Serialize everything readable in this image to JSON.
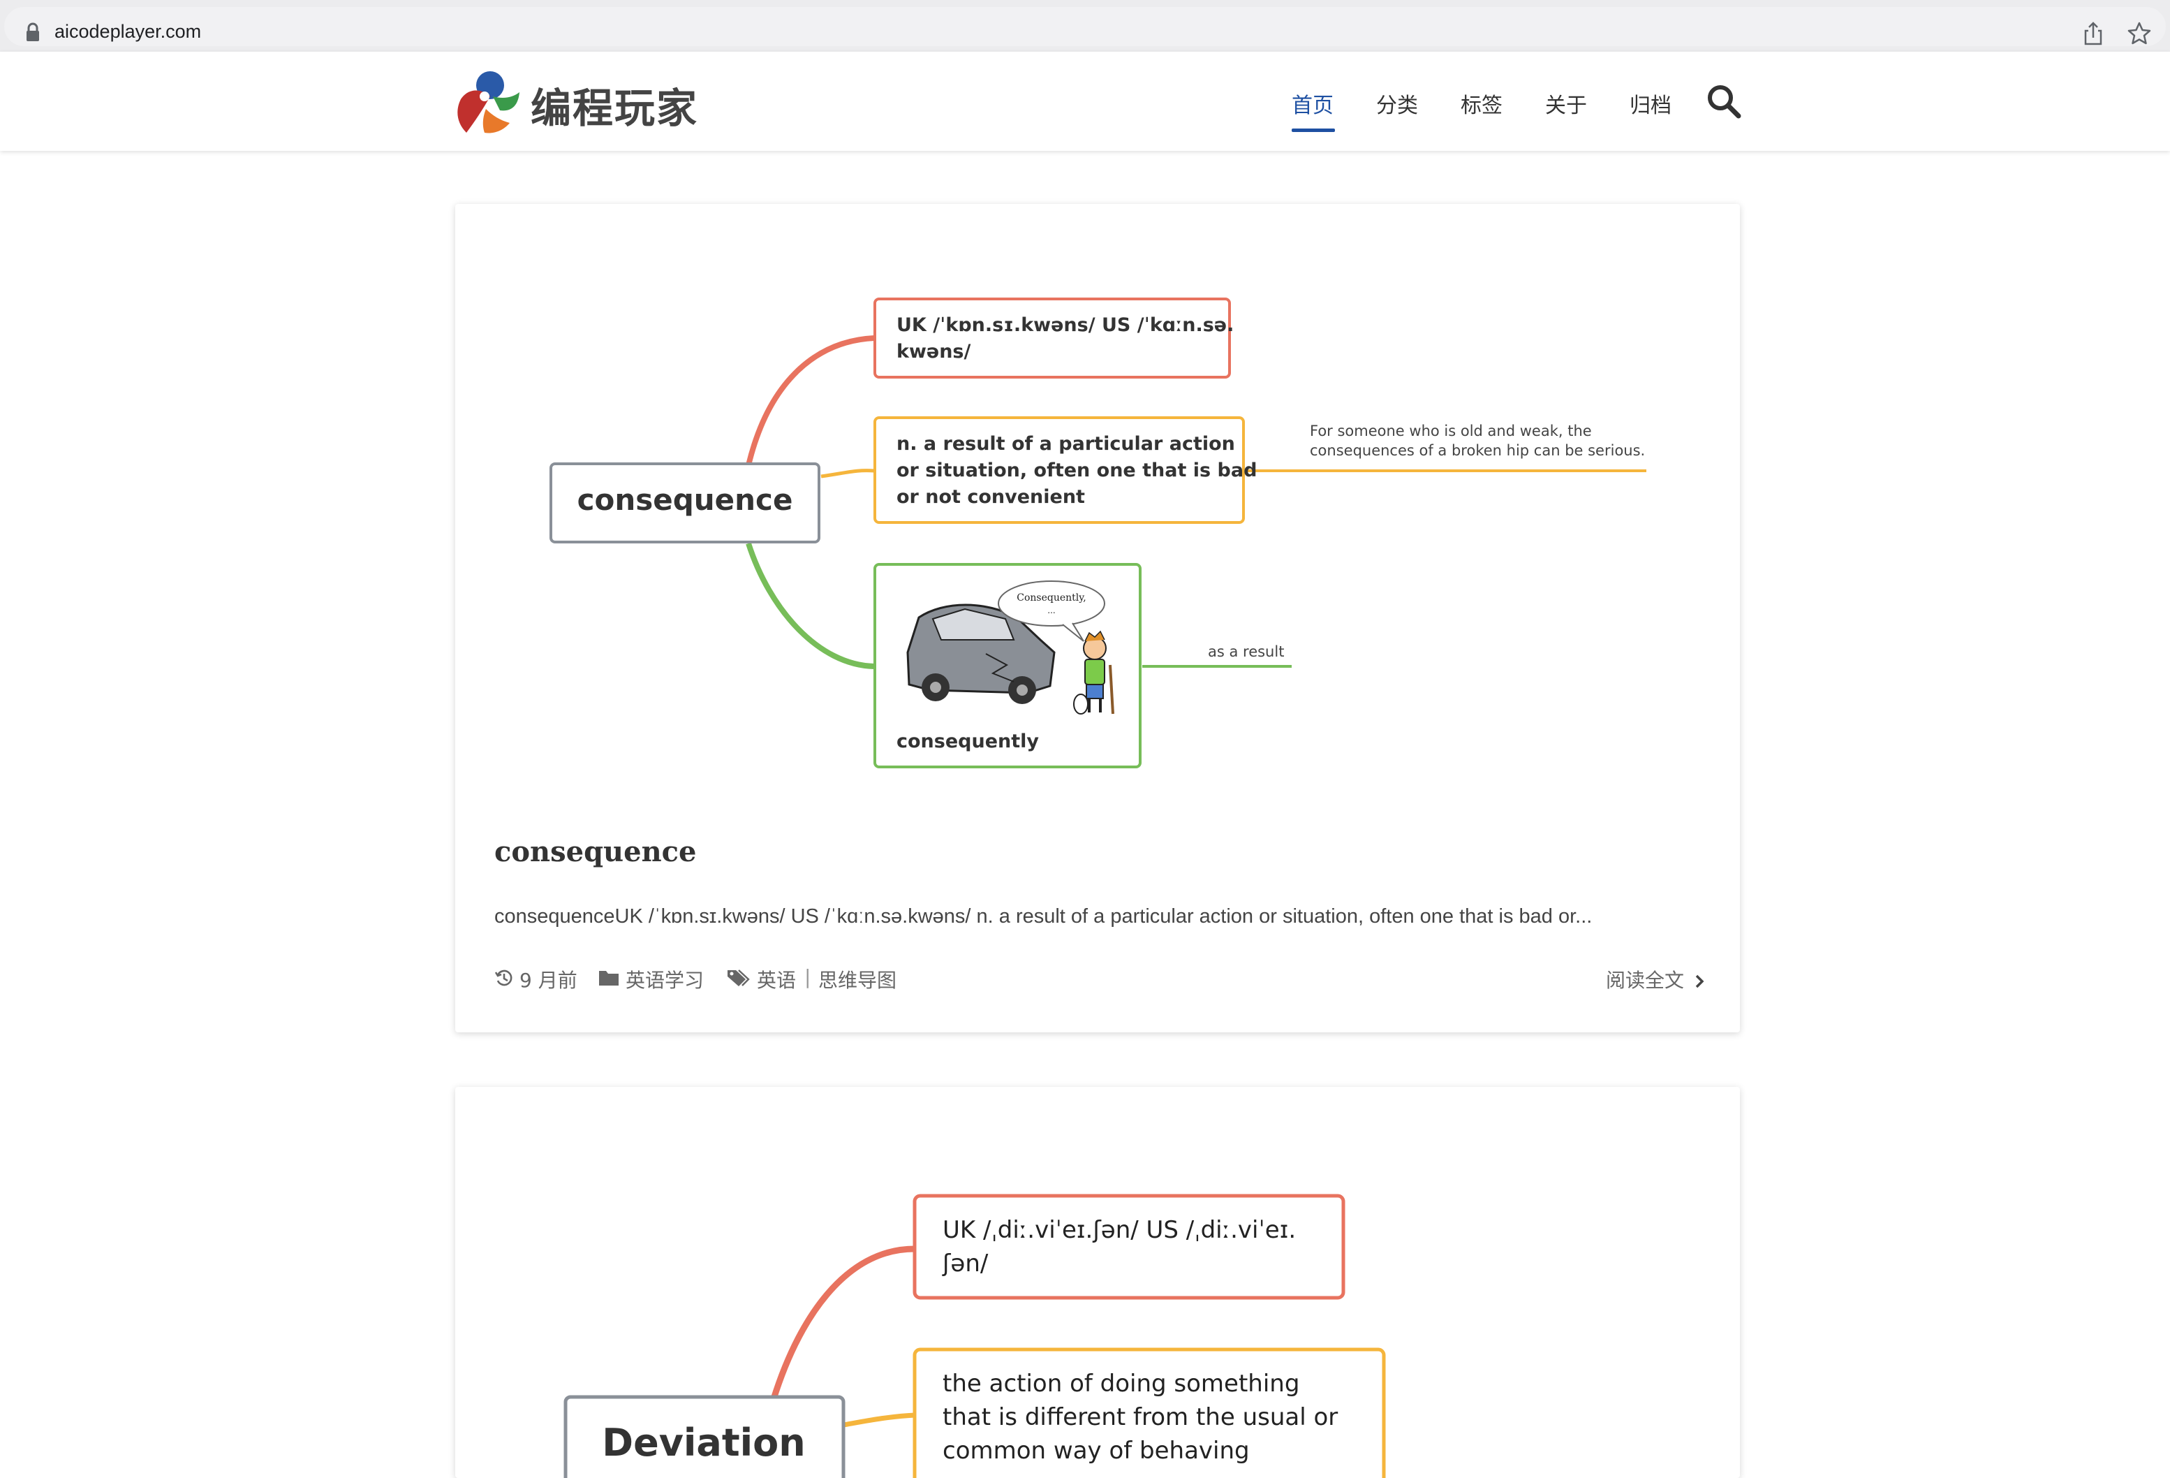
{
  "browser": {
    "url": "aicodeplayer.com"
  },
  "site": {
    "logo_text": "编程玩家",
    "nav": [
      "首页",
      "分类",
      "标签",
      "关于",
      "归档"
    ]
  },
  "posts": [
    {
      "mindmap": {
        "central": "consequence",
        "pron_line1": "UK  /ˈkɒn.sɪ.kwəns/ US  /ˈkɑːn.sə.",
        "pron_line2": "kwəns/",
        "def_line1": "n. a result of a particular action",
        "def_line2": "or situation, often one that is bad",
        "def_line3": "or not convenient",
        "example_line1": "For someone who is old and weak, the",
        "example_line2": "consequences of a broken hip can be serious.",
        "image_caption": "consequently",
        "speech_bubble": "Consequently,",
        "speech_dots": "...",
        "branch_note": "as a result"
      },
      "title": "consequence",
      "excerpt": "consequenceUK /ˈkɒn.sɪ.kwəns/ US /ˈkɑːn.sə.kwəns/ n. a result of a particular action or situation, often one that is bad or...",
      "time": "9 月前",
      "category": "英语学习",
      "tag1": "英语",
      "tag_sep": "|",
      "tag2": "思维导图",
      "read_more": "阅读全文"
    },
    {
      "mindmap": {
        "central": "Deviation",
        "pron_line1": "UK  /ˌdiː.viˈeɪ.ʃən/ US  /ˌdiː.viˈeɪ.",
        "pron_line2": "ʃən/",
        "def_line1": "the action of doing something",
        "def_line2": "that is different from the usual or",
        "def_line3": "common way of behaving"
      }
    }
  ],
  "colors": {
    "accent": "#1e50a2",
    "branch_red": "#e8735f",
    "branch_yellow": "#f5b53c",
    "branch_green": "#77bd59",
    "central_border": "#8a9098"
  }
}
